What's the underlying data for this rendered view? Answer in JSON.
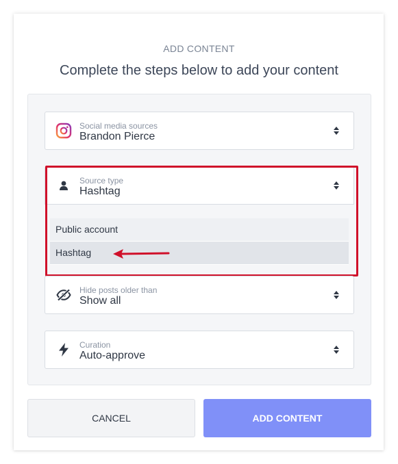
{
  "dialog": {
    "kicker": "ADD CONTENT",
    "heading": "Complete the steps below to add your content"
  },
  "fields": {
    "social_source": {
      "label": "Social media sources",
      "value": "Brandon Pierce",
      "icon": "instagram-icon"
    },
    "source_type": {
      "label": "Source type",
      "value": "Hashtag",
      "icon": "person-icon"
    },
    "hide_posts": {
      "label": "Hide posts older than",
      "value": "Show all",
      "icon": "eye-slash-icon"
    },
    "curation": {
      "label": "Curation",
      "value": "Auto-approve",
      "icon": "lightning-icon"
    }
  },
  "dropdown": {
    "options": [
      "Public account",
      "Hashtag"
    ],
    "highlighted": "Hashtag"
  },
  "buttons": {
    "cancel": "CANCEL",
    "add": "ADD CONTENT"
  },
  "colors": {
    "accent": "#8090f8",
    "annotation_red": "#d0102a"
  }
}
